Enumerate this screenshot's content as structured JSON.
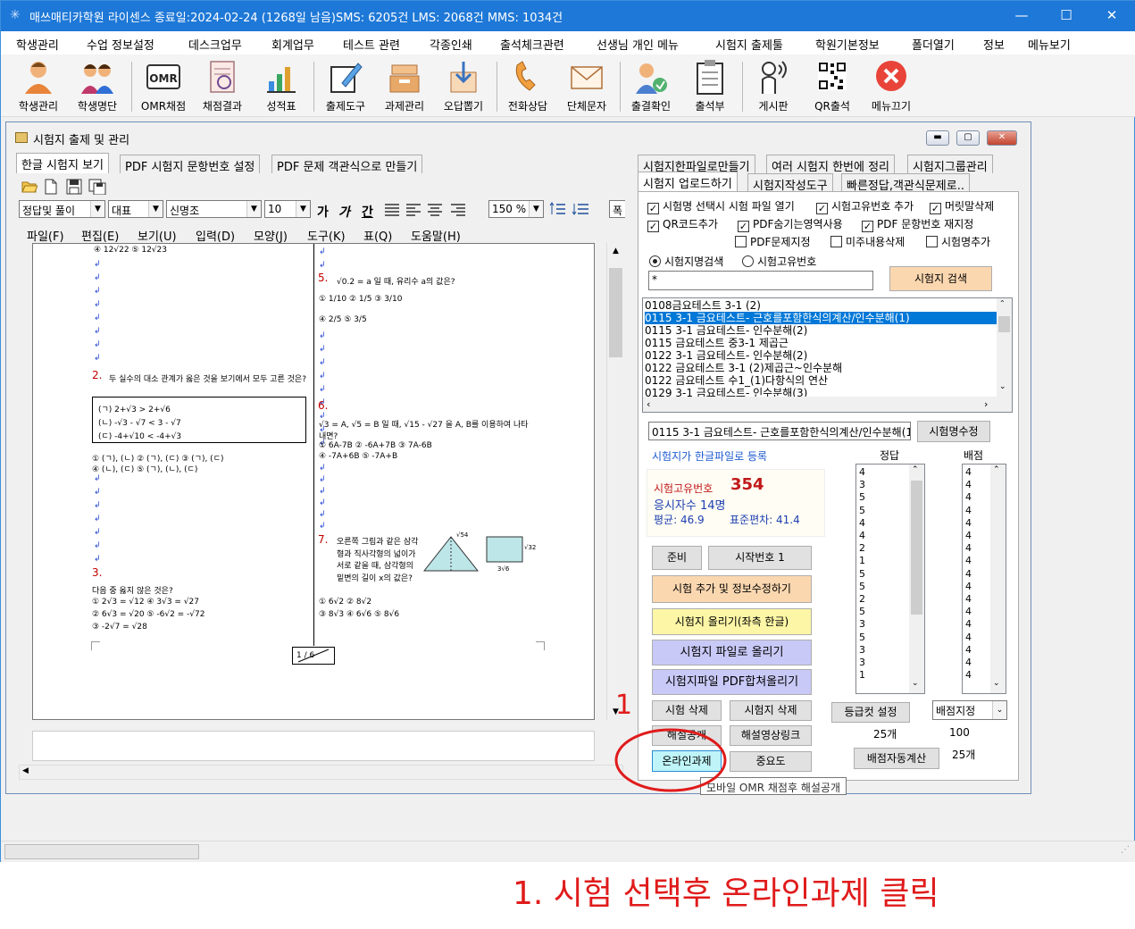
{
  "window": {
    "title": "매쓰매티카학원  라이센스 종료일:2024-02-24 (1268일 남음)SMS: 6205건 LMS: 2068건 MMS: 1034건"
  },
  "menu": [
    "학생관리",
    "수업 정보설정",
    "데스크업무",
    "회계업무",
    "테스트 관련",
    "각종인쇄",
    "출석체크관련",
    "선생님 개인 메뉴",
    "시험지 출제툴",
    "학원기본정보",
    "폴더열기",
    "정보",
    "메뉴보기"
  ],
  "toolbar": [
    "학생관리",
    "학생명단",
    "OMR채점",
    "채점결과",
    "성적표",
    "출제도구",
    "과제관리",
    "오답뽑기",
    "전화상담",
    "단체문자",
    "출결확인",
    "출석부",
    "게시판",
    "QR출석",
    "메뉴끄기"
  ],
  "child": {
    "title": "시험지 출제 및 관리"
  },
  "left_tabs": [
    "한글 시험지 보기",
    "PDF 시험지 문항번호 설정",
    "PDF 문제 객관식으로 만들기"
  ],
  "hwp": {
    "style": "정답및 풀이",
    "lang": "대표",
    "font": "신명조",
    "size": "10",
    "zoom": "150 %",
    "fmt": [
      "가",
      "가",
      "간"
    ],
    "width_btn": "폭",
    "menu": [
      "파일(F)",
      "편집(E)",
      "보기(U)",
      "입력(D)",
      "모양(J)",
      "도구(K)",
      "표(Q)",
      "도움말(H)"
    ]
  },
  "doc": {
    "left": {
      "top_line": "④ 12√22       ⑤ 12√23",
      "q2_num": "2.",
      "q2_text": "두 실수의 대소 관계가 옳은 것을 보기에서 모두 고른 것은?",
      "q2_box": [
        "(ㄱ) 2+√3 > 2+√6",
        "(ㄴ) -√3 - √7 < 3 - √7",
        "(ㄷ) -4+√10 < -4+√3"
      ],
      "q2_opts_1": "① (ㄱ), (ㄴ)    ② (ㄱ), (ㄷ)    ③ (ㄱ), (ㄷ)",
      "q2_opts_2": "④ (ㄴ), (ㄷ)    ⑤ (ㄱ), (ㄴ), (ㄷ)",
      "q3_num": "3.",
      "q3_text": "다음 중 옳지 않은 것은?",
      "q3_opts_1": "① 2√3 = √12        ④ 3√3 = √27",
      "q3_opts_2": "② 6√3 = √20        ⑤ -6√2 = -√72",
      "q3_opts_3": "③ -2√7 = √28",
      "page_box": "1 / 6"
    },
    "right": {
      "q5_num": "5.",
      "q5_text": "√0.2 = a 일 때, 유리수 a의 값은?",
      "q5_opts_1": "① 1/10      ② 1/5      ③ 3/10",
      "q5_opts_2": "④ 2/5      ⑤ 3/5",
      "q6_num": "6.",
      "q6_text": "√3 = A, √5 = B 일 때, √15 - √27 을 A, B를 이용하여 나타내면?",
      "q6_opts_1": "① 6A-7B     ② -6A+7B     ③ 7A-6B",
      "q6_opts_2": "④ -7A+6B    ⑤ -7A+B",
      "q7_num": "7.",
      "q7_text": "오른쪽 그림과 같은 삼각형과 직사각형의 넓이가 서로 같을 때, 삼각형의 밑변의 길이 x의 값은?",
      "q7_fig1": "√54",
      "q7_fig2": "√32",
      "q7_fig3": "3√6",
      "q7_opts_1": "① 6√2       ② 8√2",
      "q7_opts_2": "③ 8√3       ④ 6√6       ⑤ 8√6"
    }
  },
  "right_tabs": {
    "row1": [
      "시험지한파일로만들기",
      "여러 시험지 한번에 정리",
      "시험지그룹관리"
    ],
    "row2": [
      "시험지 업로드하기",
      "시험지작성도구",
      "빠른정답,객관식문제로.."
    ]
  },
  "checks": [
    {
      "label": "시험명 선택시 시험 파일 열기",
      "checked": true
    },
    {
      "label": "시험고유번호 추가",
      "checked": true
    },
    {
      "label": "머릿말삭제",
      "checked": true
    },
    {
      "label": "QR코드추가",
      "checked": true
    },
    {
      "label": "PDF숨기는영역사용",
      "checked": true
    },
    {
      "label": "PDF 문항번호 재지정",
      "checked": true
    },
    {
      "label": "PDF문제지정",
      "checked": false
    },
    {
      "label": "미주내용삭제",
      "checked": false
    },
    {
      "label": "시험명추가",
      "checked": false
    }
  ],
  "search": {
    "radio1": "시험지명검색",
    "radio2": "시험고유번호",
    "value": "*",
    "button": "시험지 검색"
  },
  "exam_list": [
    "0108금요테스트 3-1 (2)",
    "0115 3-1 금요테스트- 근호를포함한식의계산/인수분해(1)",
    "0115 3-1 금요테스트- 인수분해(2)",
    "0115 금요테스트 중3-1 제곱근",
    "0122 3-1 금요테스트- 인수분해(2)",
    "0122 금요테스트 3-1 (2)제곱근~인수분해",
    "0122 금요테스트 수1_(1)다항식의 연산",
    "0129 3-1 금요테스트- 인수분해(3)"
  ],
  "selected_name": "0115 3-1 금요테스트- 근호를포함한식의계산/인수분해(1)",
  "rename_btn": "시험명수정",
  "hangul_link": "시험지가 한글파일로 등록",
  "stats": {
    "id_label": "시험고유번호",
    "id_value": "354",
    "takers": "응시자수   14명",
    "avg": "평균: 46.9",
    "std": "표준편차:  41.4"
  },
  "answer_header": "정답",
  "score_header": "배점",
  "answers": [
    "4",
    "3",
    "5",
    "5",
    "4",
    "4",
    "2",
    "1",
    "5",
    "5",
    "2",
    "5",
    "3",
    "5",
    "3",
    "3",
    "1"
  ],
  "scores": [
    "4",
    "4",
    "4",
    "4",
    "4",
    "4",
    "4",
    "4",
    "4",
    "4",
    "4",
    "4",
    "4",
    "4",
    "4",
    "4",
    "4"
  ],
  "buttons": {
    "ready": "준비",
    "start": "시작번호 1",
    "add": "시험 추가 및 정보수정하기",
    "upload_hwp": "시험지 올리기(좌측 한글)",
    "upload_file": "시험지 파일로 올리기",
    "upload_pdf": "시험지파일 PDF합쳐올리기",
    "del_exam": "시험 삭제",
    "del_paper": "시험지 삭제",
    "solution": "해설공개",
    "video": "해설영상링크",
    "online": "온라인과제",
    "important": "중요도",
    "grade_cut": "등급컷 설정",
    "auto_score": "배점자동계산",
    "score_select": "배점지정"
  },
  "counts": {
    "answers": "25개",
    "total": "100",
    "scores": "25개"
  },
  "tooltip": "모바일 OMR 채점후 해설공개",
  "annotation": {
    "marker": "1",
    "caption": "1. 시험 선택후 온라인과제 클릭",
    "color": "#e01b1b"
  },
  "colors": {
    "title_bar": "#1e78d7",
    "selection": "#0078d7",
    "btn_orange": "#fbd7b0",
    "btn_yellow": "#fdf6a6",
    "btn_purple": "#c9c9f7",
    "btn_cyan": "#bff4f8"
  }
}
